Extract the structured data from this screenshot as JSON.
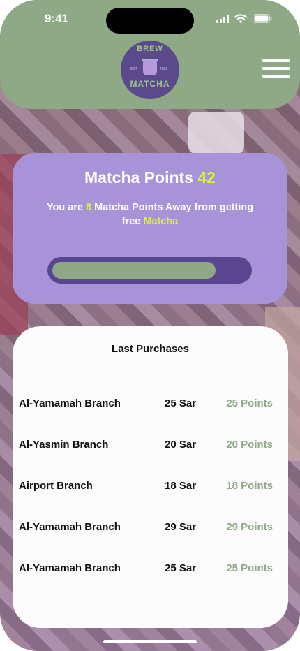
{
  "status_bar": {
    "time": "9:41"
  },
  "logo": {
    "top_text": "BREW",
    "bottom_text": "MATCHA",
    "est_text": "EST",
    "year_text": "2022"
  },
  "points": {
    "title_label": "Matcha Points",
    "value": "42",
    "message_prefix": "You are",
    "points_away": "8",
    "message_middle": "Matcha Points Away from getting free",
    "reward": "Matcha",
    "progress_fraction": 0.84
  },
  "purchases": {
    "title": "Last Purchases",
    "rows": [
      {
        "branch": "Al-Yamamah Branch",
        "amount": "25 Sar",
        "points": "25 Points"
      },
      {
        "branch": "Al-Yasmin Branch",
        "amount": "20 Sar",
        "points": "20 Points"
      },
      {
        "branch": "Airport Branch",
        "amount": "18 Sar",
        "points": "18 Points"
      },
      {
        "branch": "Al-Yamamah Branch",
        "amount": "29 Sar",
        "points": "29 Points"
      },
      {
        "branch": "Al-Yamamah Branch",
        "amount": "25 Sar",
        "points": "25 Points"
      }
    ]
  },
  "icons": [
    "signal-icon",
    "wifi-icon",
    "battery-icon",
    "menu-icon"
  ],
  "colors": {
    "header_green": "#8fa886",
    "card_purple": "#a893d8",
    "highlight": "#d7f33a",
    "track_purple": "#5a4690"
  }
}
